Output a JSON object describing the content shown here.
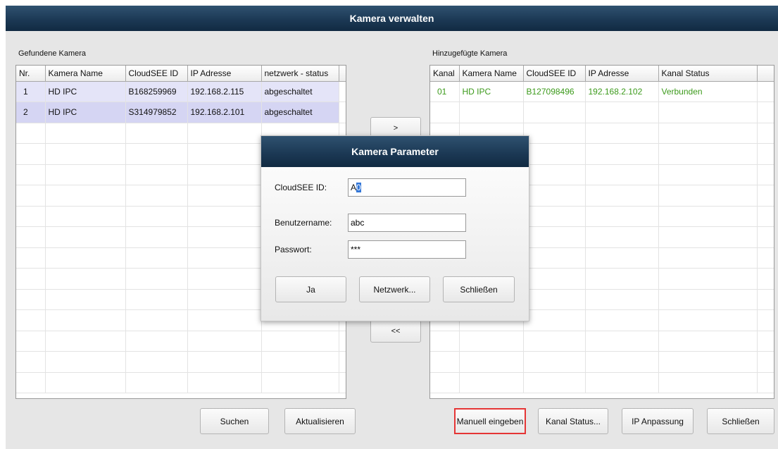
{
  "window": {
    "title": "Kamera verwalten"
  },
  "found": {
    "label": "Gefundene Kamera",
    "columns": [
      "Nr.",
      "Kamera Name",
      "CloudSEE ID",
      "IP Adresse",
      "netzwerk - status"
    ],
    "rows": [
      [
        "1",
        "HD IPC",
        "B168259969",
        "192.168.2.115",
        "abgeschaltet"
      ],
      [
        "2",
        "HD IPC",
        "S314979852",
        "192.168.2.101",
        "abgeschaltet"
      ]
    ]
  },
  "added": {
    "label": "Hinzugefügte Kamera",
    "columns": [
      "Kanal",
      "Kamera Name",
      "CloudSEE ID",
      "IP Adresse",
      "Kanal Status"
    ],
    "rows": [
      [
        "01",
        "HD IPC",
        "B127098496",
        "192.168.2.102",
        "Verbunden"
      ]
    ]
  },
  "transfer": {
    "add_label": ">",
    "remove_label": "<<"
  },
  "buttons": {
    "search": "Suchen",
    "refresh": "Aktualisieren",
    "manual": "Manuell eingeben",
    "channel_status": "Kanal Status...",
    "ip_adjust": "IP Anpassung",
    "close": "Schließen"
  },
  "dialog": {
    "title": "Kamera Parameter",
    "cloudsee_label": "CloudSEE ID:",
    "cloudsee_value_prefix": "A",
    "cloudsee_value_selected": "0",
    "username_label": "Benutzername:",
    "username_value": "abc",
    "password_label": "Passwort:",
    "password_value": "***",
    "ok": "Ja",
    "network": "Netzwerk...",
    "close": "Schließen"
  },
  "colors": {
    "titlebar": "#1c3955",
    "connected_text": "#3c9a1b",
    "selection_highlight": "#3477d8",
    "manual_button_outline": "#e53535"
  }
}
